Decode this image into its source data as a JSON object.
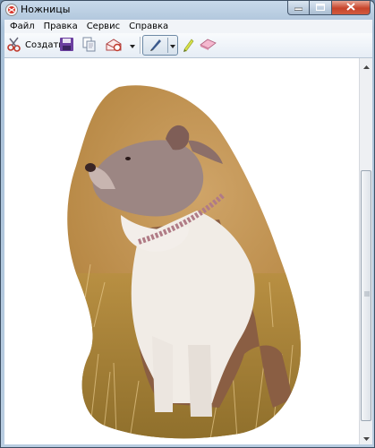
{
  "window": {
    "title": "Ножницы",
    "accent": "#c7442b"
  },
  "menu": {
    "items": [
      {
        "label": "Файл"
      },
      {
        "label": "Правка"
      },
      {
        "label": "Сервис"
      },
      {
        "label": "Справка"
      }
    ]
  },
  "toolbar": {
    "new_label": "Создать",
    "icons": [
      "scissors-icon",
      "save-icon",
      "copy-icon",
      "send-icon",
      "pen-icon",
      "highlighter-icon",
      "eraser-icon"
    ]
  },
  "canvas": {
    "image_description_icon": "snip-image"
  }
}
